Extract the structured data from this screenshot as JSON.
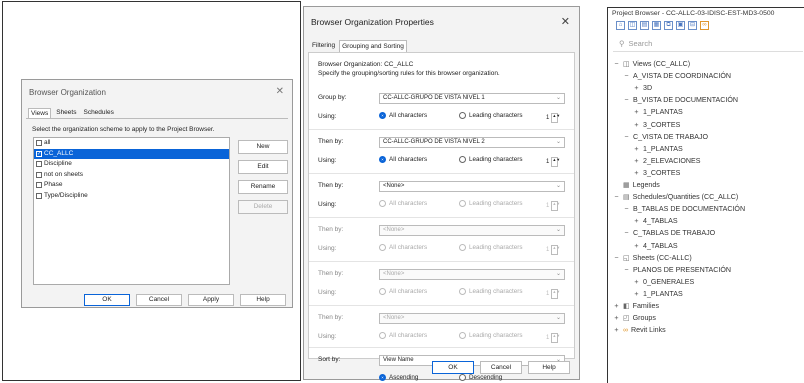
{
  "browser_organization": {
    "title": "Browser Organization",
    "tabs": [
      "Views",
      "Sheets",
      "Schedules"
    ],
    "instruction": "Select the organization scheme to apply to the Project Browser.",
    "schemes": [
      {
        "label": "all",
        "checked": false,
        "selected": false
      },
      {
        "label": "CC_ALLC",
        "checked": true,
        "selected": true
      },
      {
        "label": "Discipline",
        "checked": false,
        "selected": false
      },
      {
        "label": "not on sheets",
        "checked": false,
        "selected": false
      },
      {
        "label": "Phase",
        "checked": false,
        "selected": false
      },
      {
        "label": "Type/Discipline",
        "checked": false,
        "selected": false
      }
    ],
    "side_buttons": {
      "new": "New",
      "edit": "Edit",
      "rename": "Rename",
      "delete": "Delete"
    },
    "bottom_buttons": {
      "ok": "OK",
      "cancel": "Cancel",
      "apply": "Apply",
      "help": "Help"
    }
  },
  "properties_dialog": {
    "title": "Browser Organization Properties",
    "tabs": [
      "Filtering",
      "Grouping and Sorting"
    ],
    "org_line": "Browser Organization: CC_ALLC",
    "spec_line": "Specify the grouping/sorting rules for this browser organization.",
    "group_by_label": "Group by:",
    "then_by_label": "Then by:",
    "using_label": "Using:",
    "all_chars": "All characters",
    "leading_chars": "Leading characters",
    "spin_value": "1",
    "groups": [
      {
        "value": "CC-ALLC-GRUPO DE VISTA NIVEL 1",
        "disabled": false
      },
      {
        "value": "CC-ALLC-GRUPO DE VISTA NIVEL 2",
        "disabled": false
      },
      {
        "value": "<None>",
        "disabled": false
      },
      {
        "value": "<None>",
        "disabled": true
      },
      {
        "value": "<None>",
        "disabled": true
      },
      {
        "value": "<None>",
        "disabled": true
      }
    ],
    "sort_by_label": "Sort by:",
    "sort_by_value": "View Name",
    "ascending": "Ascending",
    "descending": "Descending",
    "buttons": {
      "ok": "OK",
      "cancel": "Cancel",
      "help": "Help"
    }
  },
  "project_browser": {
    "title": "Project Browser - CC-ALLC-03-IDISC-EST-MD3-0500",
    "search_placeholder": "Search",
    "tree": [
      {
        "label": "Views (CC_ALLC)",
        "exp": "−",
        "icon": "views-icon",
        "glyph": "◫"
      },
      {
        "label": "A_VISTA DE COORDINACIÓN",
        "exp": "−",
        "icon": "",
        "glyph": ""
      },
      {
        "label": "3D",
        "exp": "+",
        "icon": "",
        "glyph": ""
      },
      {
        "label": "B_VISTA DE DOCUMENTACIÓN",
        "exp": "−",
        "icon": "",
        "glyph": ""
      },
      {
        "label": "1_PLANTAS",
        "exp": "+",
        "icon": "",
        "glyph": ""
      },
      {
        "label": "3_CORTES",
        "exp": "+",
        "icon": "",
        "glyph": ""
      },
      {
        "label": "C_VISTA DE TRABAJO",
        "exp": "−",
        "icon": "",
        "glyph": ""
      },
      {
        "label": "1_PLANTAS",
        "exp": "+",
        "icon": "",
        "glyph": ""
      },
      {
        "label": "2_ELEVACIONES",
        "exp": "+",
        "icon": "",
        "glyph": ""
      },
      {
        "label": "3_CORTES",
        "exp": "+",
        "icon": "",
        "glyph": ""
      },
      {
        "label": "Legends",
        "exp": "",
        "icon": "legends-icon",
        "glyph": "▦"
      },
      {
        "label": "Schedules/Quantities (CC_ALLC)",
        "exp": "−",
        "icon": "schedule-icon",
        "glyph": "▤"
      },
      {
        "label": "B_TABLAS DE DOCUMENTACIÓN",
        "exp": "−",
        "icon": "",
        "glyph": ""
      },
      {
        "label": "4_TABLAS",
        "exp": "+",
        "icon": "",
        "glyph": ""
      },
      {
        "label": "C_TABLAS DE TRABAJO",
        "exp": "−",
        "icon": "",
        "glyph": ""
      },
      {
        "label": "4_TABLAS",
        "exp": "+",
        "icon": "",
        "glyph": ""
      },
      {
        "label": "Sheets (CC-ALLC)",
        "exp": "−",
        "icon": "sheets-icon",
        "glyph": "◱"
      },
      {
        "label": "PLANOS DE PRESENTACIÓN",
        "exp": "−",
        "icon": "",
        "glyph": ""
      },
      {
        "label": "0_GENERALES",
        "exp": "+",
        "icon": "",
        "glyph": ""
      },
      {
        "label": "1_PLANTAS",
        "exp": "+",
        "icon": "",
        "glyph": ""
      },
      {
        "label": "Families",
        "exp": "+",
        "icon": "families-icon",
        "glyph": "◧"
      },
      {
        "label": "Groups",
        "exp": "+",
        "icon": "groups-icon",
        "glyph": "◰"
      },
      {
        "label": "Revit Links",
        "exp": "+",
        "icon": "link-icon",
        "glyph": "∞"
      }
    ],
    "toolbar_icons": [
      "home-icon",
      "view-icon",
      "list-icon",
      "grid-icon",
      "copy-icon",
      "cube-icon",
      "layout-icon",
      "link-icon"
    ],
    "accent_color": "#0a64d8"
  }
}
